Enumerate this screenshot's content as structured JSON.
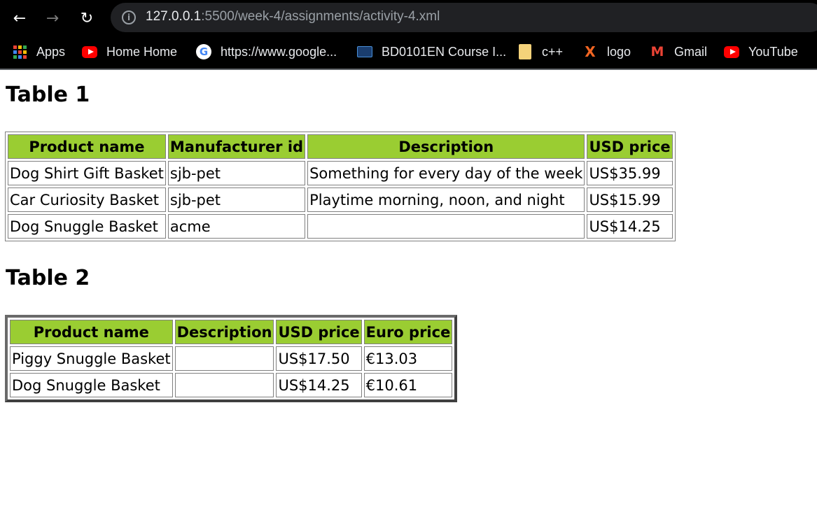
{
  "browser": {
    "url_host": "127.0.0.1",
    "url_path": ":5500/week-4/assignments/activity-4.xml",
    "bookmarks": [
      {
        "label": "Apps",
        "icon": "apps-grid-icon"
      },
      {
        "label": "Home Home",
        "icon": "youtube-icon"
      },
      {
        "label": "https://www.google...",
        "icon": "google-icon"
      },
      {
        "label": "BD0101EN Course I...",
        "icon": "course-icon"
      },
      {
        "label": "c++",
        "icon": "folder-icon"
      },
      {
        "label": "logo",
        "icon": "x-logo-icon"
      },
      {
        "label": "Gmail",
        "icon": "gmail-icon"
      },
      {
        "label": "YouTube",
        "icon": "youtube-icon"
      }
    ]
  },
  "table1": {
    "title": "Table 1",
    "headers": [
      "Product name",
      "Manufacturer id",
      "Description",
      "USD price"
    ],
    "rows": [
      [
        "Dog Shirt Gift Basket",
        "sjb-pet",
        "Something for every day of the week",
        "US$35.99"
      ],
      [
        "Car Curiosity Basket",
        "sjb-pet",
        "Playtime morning, noon, and night",
        "US$15.99"
      ],
      [
        "Dog Snuggle Basket",
        "acme",
        "",
        "US$14.25"
      ]
    ]
  },
  "table2": {
    "title": "Table 2",
    "headers": [
      "Product name",
      "Description",
      "USD price",
      "Euro price"
    ],
    "rows": [
      [
        "Piggy Snuggle Basket",
        "",
        "US$17.50",
        "€13.03"
      ],
      [
        "Dog Snuggle Basket",
        "",
        "US$14.25",
        "€10.61"
      ]
    ]
  },
  "colors": {
    "header_bg": "#9acd32",
    "browser_bg": "#000000"
  }
}
